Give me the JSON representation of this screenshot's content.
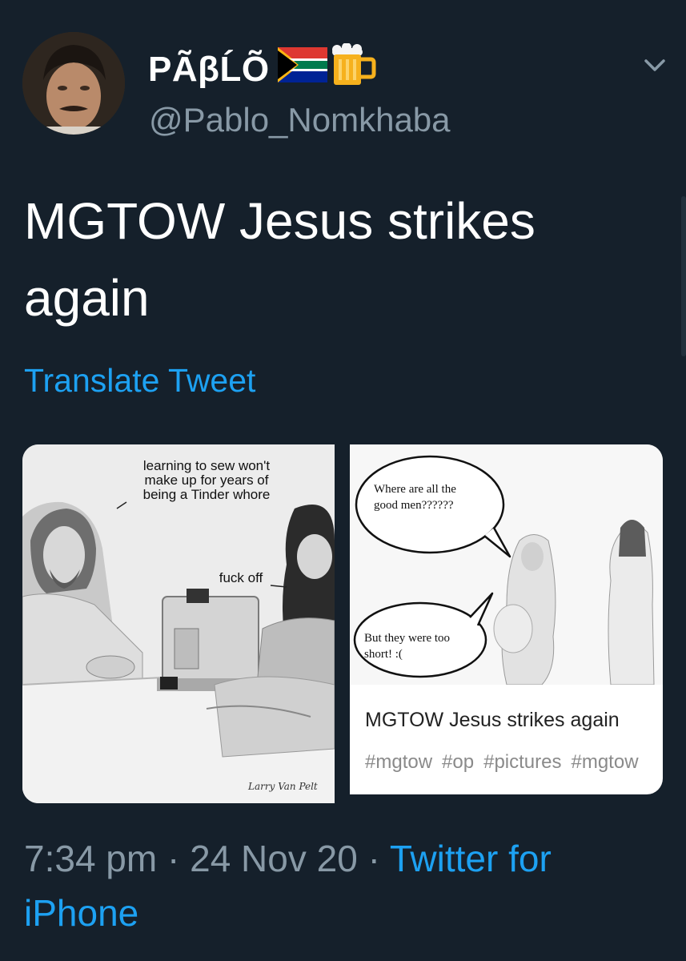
{
  "tweet": {
    "display_name": "PÃβĹÕ",
    "flag_icon": "south-africa-flag-icon",
    "beer_icon": "beer-mug-icon",
    "handle": "@Pablo_Nomkhaba",
    "text": "MGTOW Jesus strikes again",
    "translate_label": "Translate Tweet",
    "time": "7:34 pm",
    "separator": " · ",
    "date": "24 Nov 20",
    "source": "Twitter for iPhone"
  },
  "media": {
    "left_image": {
      "caption_top": "learning to sew won't make up for years of being a Tinder whore",
      "caption_mid": "fuck off",
      "signature": "Larry Van Pelt"
    },
    "right_card": {
      "bubble_top": "Where are all the good men??????",
      "bubble_bottom": "But they were too short! :(",
      "title": "MGTOW Jesus strikes again",
      "tags": [
        "#mgtow",
        "#op",
        "#pictures",
        "#mgtow"
      ]
    }
  },
  "colors": {
    "background": "#15202b",
    "text": "#ffffff",
    "secondary": "#8899a6",
    "accent": "#1da1f2"
  }
}
